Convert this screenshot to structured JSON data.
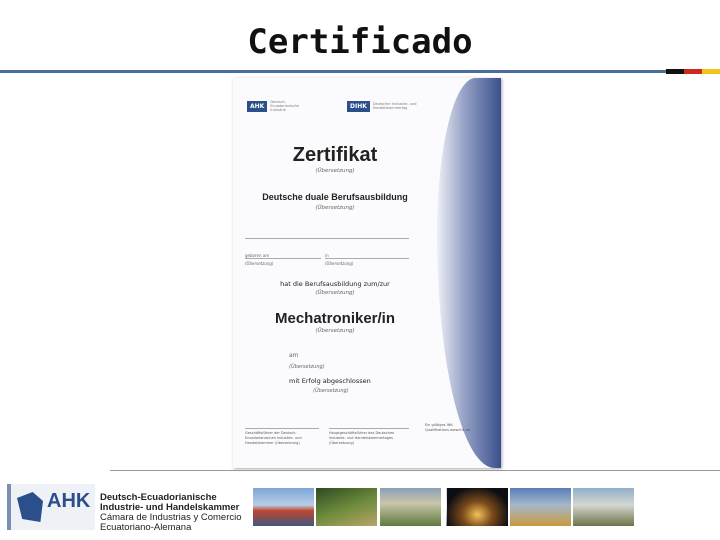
{
  "slide": {
    "title": "Certificado"
  },
  "certificate": {
    "org_left": "AHK",
    "org_left_sub": "Deutsch-Ecuadorianische Industrie",
    "org_right": "DIHK",
    "org_right_sub": "Deutscher Industrie- und Handelskammertag",
    "title": "Zertifikat",
    "title_note": "(Übersetzung)",
    "program": "Deutsche duale Berufsausbildung",
    "program_note": "(Übersetzung)",
    "born_label": "geboren am",
    "born_note": "(Übersetzung)",
    "in_label": "in",
    "in_note": "(Übersetzung)",
    "statement": "hat die Berufsausbildung zum/zur",
    "statement_note": "(Übersetzung)",
    "profession": "Mechatroniker/in",
    "profession_note": "(Übersetzung)",
    "on_label": "am",
    "on_note": "(Übersetzung)",
    "completed": "mit Erfolg abgeschlossen",
    "completed_note": "(Übersetzung)",
    "footer_left": "Geschäftsführer der Deutsch-Ecuadorianischen Industrie- und Handelskammer (Übersetzung)",
    "footer_mid": "Hauptgeschäftsführer des Deutschen Industrie- und Handelskammertages (Übersetzung)",
    "footer_right": "Ein gültiges IHK-Qualifikations www.ihk.de"
  },
  "footer": {
    "logo_text": "AHK",
    "chamber_line1": "Deutsch-Ecuadorianische",
    "chamber_line2": "Industrie- und Handelskammer",
    "chamber_line3": "Cámara de Industrias y Comercio",
    "chamber_line4": "Ecuatoriano-Alemana"
  },
  "colors": {
    "accent": "#4a6d9c",
    "brand": "#2b4f8a"
  }
}
